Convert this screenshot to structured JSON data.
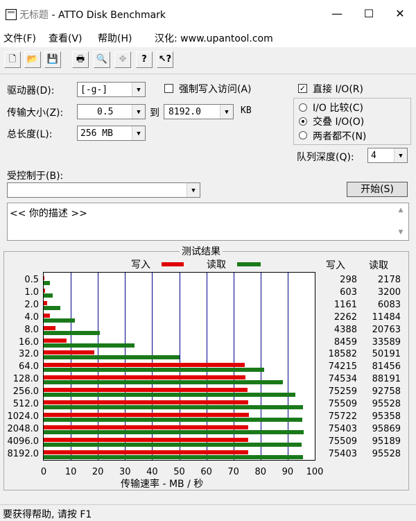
{
  "window": {
    "title_part1": "无标题",
    "title_part2": " - ATTO Disk Benchmark",
    "minimize": "—",
    "maximize": "☐",
    "close": "✕"
  },
  "menu": [
    "文件(F)",
    "查看(V)",
    "帮助(H)",
    "汉化: www.upantool.com"
  ],
  "toolbar": {
    "icons": [
      "new-icon",
      "open-icon",
      "save-icon",
      "print-icon",
      "print-preview-icon",
      "move-icon",
      "help-icon",
      "context-help-icon"
    ],
    "glyphs": [
      "🗋",
      "📂",
      "💾",
      "🖶",
      "🔍",
      "✥",
      "?",
      "↖?"
    ]
  },
  "settings": {
    "drive_label": "驱动器(D):",
    "drive_value": "[-g-]",
    "transfer_label": "传输大小(Z):",
    "transfer_from": "0.5",
    "to_label": "到",
    "transfer_to": "8192.0",
    "unit": "KB",
    "total_label": "总长度(L):",
    "total_value": "256 MB",
    "force_write_label": "强制写入访问(A)",
    "direct_io_label": "直接 I/O(R)",
    "io_compare_label": "I/O 比较(C)",
    "overlap_io_label": "交叠 I/O(O)",
    "neither_label": "两者都不(N)",
    "queue_label": "队列深度(Q):",
    "queue_value": "4",
    "controlled_label": "受控制于(B):",
    "controlled_value": "",
    "start_label": "开始(S)",
    "description": "<<  你的描述  >>"
  },
  "results": {
    "title": "测试结果",
    "legend_write": "写入",
    "legend_read": "读取",
    "col_write": "写入",
    "col_read": "读取",
    "xlabel": "传输速率 - MB / 秒"
  },
  "chart_data": {
    "type": "bar",
    "orientation": "horizontal",
    "title": "测试结果",
    "xlabel": "传输速率 - MB / 秒",
    "xlim": [
      0,
      100
    ],
    "xticks": [
      0,
      10,
      20,
      30,
      40,
      50,
      60,
      70,
      80,
      90,
      100
    ],
    "categories": [
      "0.5",
      "1.0",
      "2.0",
      "4.0",
      "8.0",
      "16.0",
      "32.0",
      "64.0",
      "128.0",
      "256.0",
      "512.0",
      "1024.0",
      "2048.0",
      "4096.0",
      "8192.0"
    ],
    "series": [
      {
        "name": "写入",
        "color": "#e00000",
        "values": [
          298,
          603,
          1161,
          2262,
          4388,
          8459,
          18582,
          74215,
          74534,
          75259,
          75509,
          75722,
          75403,
          75509,
          75403
        ]
      },
      {
        "name": "读取",
        "color": "#1a7a1a",
        "values": [
          2178,
          3200,
          6083,
          11484,
          20763,
          33589,
          50191,
          81456,
          88191,
          92758,
          95528,
          95358,
          95869,
          95189,
          95528
        ]
      }
    ]
  },
  "status": "要获得帮助, 请按 F1"
}
